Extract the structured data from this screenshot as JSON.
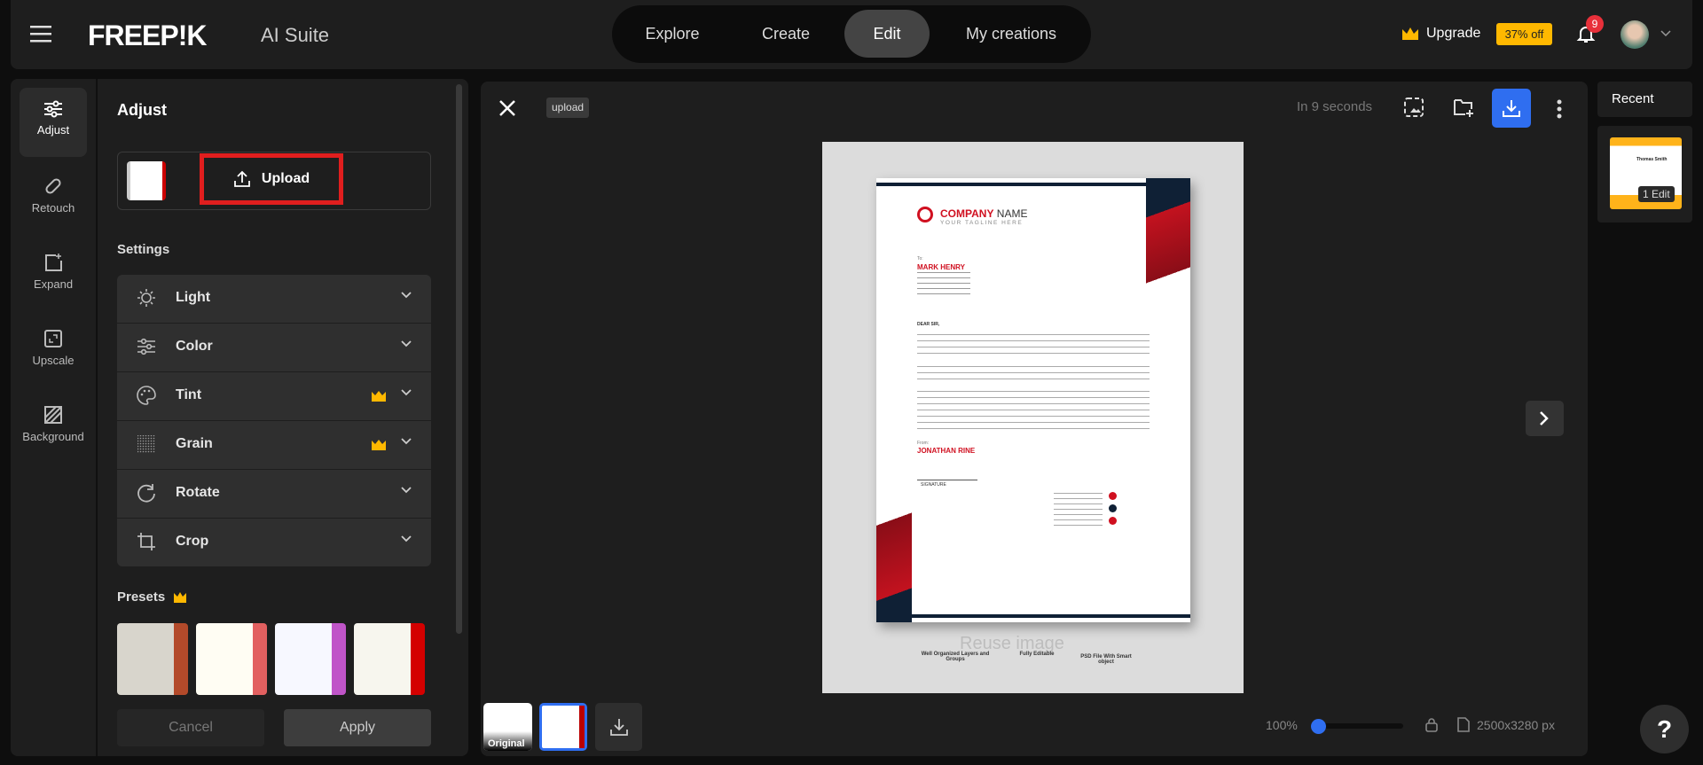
{
  "header": {
    "brand": "FREEP!K",
    "suite": "AI Suite",
    "nav": [
      {
        "label": "Explore"
      },
      {
        "label": "Create"
      },
      {
        "label": "Edit",
        "active": true
      },
      {
        "label": "My creations"
      }
    ],
    "upgrade": "Upgrade",
    "discount": "37% off",
    "notifications": "9",
    "accent": "#ffb800"
  },
  "rail": {
    "items": [
      {
        "label": "Adjust",
        "icon": "sliders-icon"
      },
      {
        "label": "Retouch",
        "icon": "bandage-icon"
      },
      {
        "label": "Expand",
        "icon": "expand-icon"
      },
      {
        "label": "Upscale",
        "icon": "upscale-icon"
      },
      {
        "label": "Background",
        "icon": "background-icon"
      }
    ]
  },
  "panel": {
    "title": "Adjust",
    "upload": "Upload",
    "settings_title": "Settings",
    "settings": [
      {
        "label": "Light",
        "icon": "sun-icon"
      },
      {
        "label": "Color",
        "icon": "sliders-icon"
      },
      {
        "label": "Tint",
        "icon": "palette-icon",
        "premium": true
      },
      {
        "label": "Grain",
        "icon": "grain-icon",
        "premium": true
      },
      {
        "label": "Rotate",
        "icon": "rotate-icon"
      },
      {
        "label": "Crop",
        "icon": "crop-icon"
      }
    ],
    "presets_title": "Presets",
    "cancel": "Cancel",
    "apply": "Apply"
  },
  "canvas": {
    "tag": "upload",
    "status": "In 9 seconds",
    "original_label": "Original",
    "zoom": "100%",
    "zoom_value": 0,
    "dimensions": "2500x3280 px",
    "accent": "#2f6ef0",
    "letter": {
      "company_bold": "COMPANY",
      "company_rest": " NAME",
      "tagline": "YOUR TAGLINE HERE",
      "to": "To:",
      "recipient": "MARK HENRY",
      "greeting": "DEAR SIR,",
      "from": "From:",
      "sender": "JONATHAN RINE",
      "signature": "SIGNATURE",
      "reuse": "Reuse image",
      "features": [
        "Well Organized Layers and Groups",
        "Fully Editable",
        "PSD File With Smart object"
      ]
    }
  },
  "recent": {
    "title": "Recent",
    "card_badge": "1 Edit",
    "card_name": "Thomas Smith"
  },
  "help": "?"
}
